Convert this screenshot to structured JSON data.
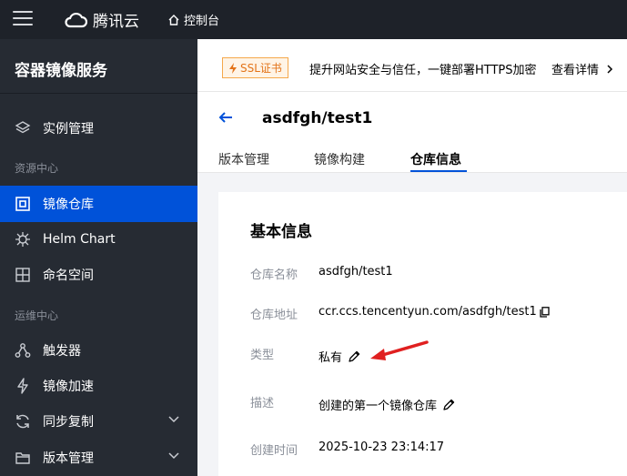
{
  "topbar": {
    "brand": "腾讯云",
    "console_label": "控制台"
  },
  "sidebar": {
    "title": "容器镜像服务",
    "items": [
      {
        "label": "实例管理",
        "icon": "layers-icon"
      },
      {
        "label": "镜像仓库",
        "icon": "repository-icon",
        "active": true
      },
      {
        "label": "Helm Chart",
        "icon": "helm-wheel-icon"
      },
      {
        "label": "命名空间",
        "icon": "namespace-grid-icon"
      },
      {
        "label": "触发器",
        "icon": "trigger-icon"
      },
      {
        "label": "镜像加速",
        "icon": "lightning-icon"
      },
      {
        "label": "同步复制",
        "icon": "sync-icon"
      },
      {
        "label": "版本管理",
        "icon": "folder-icon"
      }
    ],
    "groups": {
      "resource": "资源中心",
      "ops": "运维中心"
    }
  },
  "banner": {
    "tag": "SSL证书",
    "text": "提升网站安全与信任，一键部署HTTPS加密",
    "link": "查看详情"
  },
  "header": {
    "repo_title": "asdfgh/test1",
    "tabs": [
      {
        "label": "版本管理"
      },
      {
        "label": "镜像构建"
      },
      {
        "label": "仓库信息",
        "active": true
      }
    ]
  },
  "card": {
    "title": "基本信息",
    "rows": [
      {
        "label": "仓库名称",
        "value": "asdfgh/test1"
      },
      {
        "label": "仓库地址",
        "value": "ccr.ccs.tencentyun.com/asdfgh/test1"
      },
      {
        "label": "类型",
        "value": "私有"
      },
      {
        "label": "描述",
        "value": "创建的第一个镜像仓库"
      },
      {
        "label": "创建时间",
        "value": "2025-10-23 23:14:17"
      }
    ]
  },
  "colors": {
    "topbar_bg": "#1e2229",
    "sidebar_bg": "#262b33",
    "accent": "#0052d9",
    "annotation_arrow": "#e02020",
    "ssl_tag": "#e37318"
  }
}
